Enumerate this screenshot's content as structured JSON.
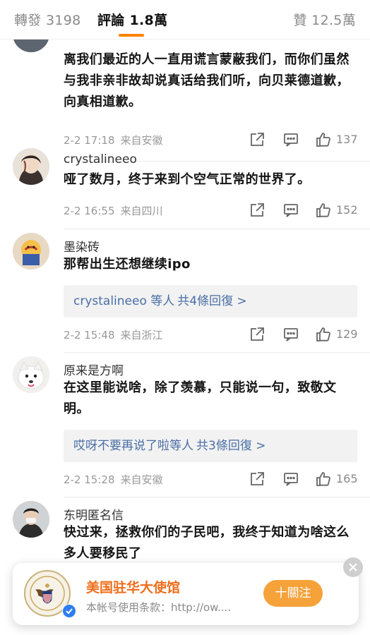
{
  "tabs": {
    "reposts": "轉發 3198",
    "comments": "評論 1.8萬",
    "likes": "贊 12.5萬"
  },
  "comments": [
    {
      "user": "",
      "text": "离我们最近的人一直用谎言蒙蔽我们，而你们虽然与我非亲非故却说真话给我们听，向贝莱德道歉，向真相道歉。",
      "time": "2-2 17:18",
      "location": "来自安徽",
      "likes": "137"
    },
    {
      "user": "crystalineeo",
      "text": "哑了数月，终于来到个空气正常的世界了。",
      "time": "2-2 16:55",
      "location": "来自四川",
      "likes": "152"
    },
    {
      "user": "墨染砖",
      "text": "那帮出生还想继续ipo",
      "replies_who": "crystalineeo 等人",
      "replies_count": "共4條回復 >",
      "time": "2-2 15:48",
      "location": "来自浙江",
      "likes": "129"
    },
    {
      "user": "原来是方啊",
      "text": "在这里能说啥，除了羡慕，只能说一句，致敬文明。",
      "replies_who": "哎呀不要再说了啦等人",
      "replies_count": "共3條回復 >",
      "time": "2-2 15:28",
      "location": "来自安徽",
      "likes": "165"
    },
    {
      "user": "东明匿名信",
      "text": "快过来，拯救你们的子民吧，我终于知道为啥这么多人要移民了"
    }
  ],
  "banner": {
    "name": "美国驻华大使馆",
    "desc": "本帐号使用条款：http://ow....",
    "follow": "十關注"
  },
  "icons": [
    "share-icon",
    "reply-icon",
    "like-icon",
    "close-icon",
    "verified-icon"
  ],
  "colors": {
    "accent": "#ff8200",
    "link": "#4a6fa5",
    "follow": "#f6a23a",
    "banner_name": "#f06d1a"
  }
}
